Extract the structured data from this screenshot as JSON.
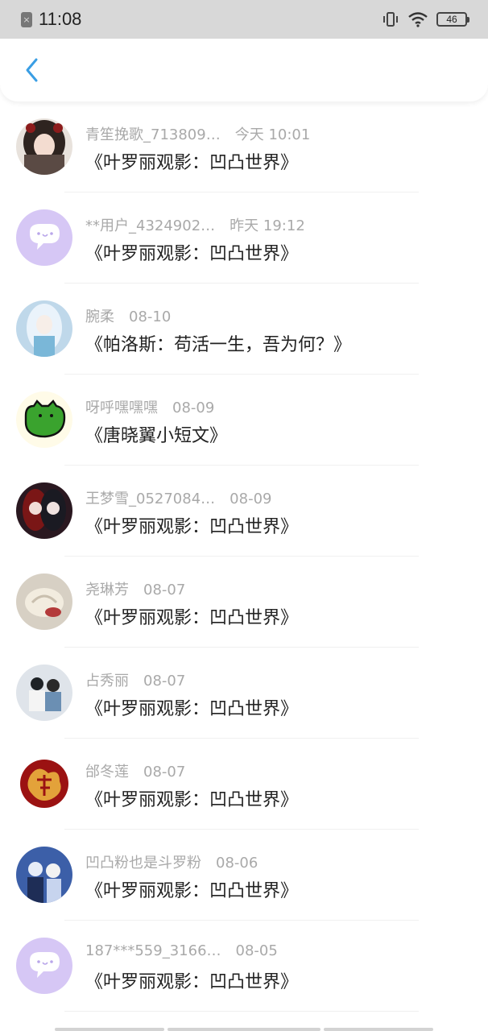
{
  "status_bar": {
    "time": "11:08",
    "battery": "46"
  },
  "nav": {
    "back_icon": "chevron-left-icon",
    "accent": "#3a9ee4"
  },
  "items": [
    {
      "name": "青笙挽歌_713809…",
      "time": "今天 10:01",
      "title": "《叶罗丽观影：凹凸世界》",
      "avatar": "anime-girl"
    },
    {
      "name": "**用户_4324902…",
      "time": "昨天 19:12",
      "title": "《叶罗丽观影：凹凸世界》",
      "avatar": "default-chat"
    },
    {
      "name": "腕柔",
      "time": "08-10",
      "title": "《帕洛斯：苟活一生，吾为何？》",
      "avatar": "blue-anime"
    },
    {
      "name": "呀呼嘿嘿嘿",
      "time": "08-09",
      "title": "《唐晓翼小短文》",
      "avatar": "green-cat"
    },
    {
      "name": "王梦雪_0527084…",
      "time": "08-09",
      "title": "《叶罗丽观影：凹凸世界》",
      "avatar": "dark-anime"
    },
    {
      "name": "尧琳芳",
      "time": "08-07",
      "title": "《叶罗丽观影：凹凸世界》",
      "avatar": "flower"
    },
    {
      "name": "占秀丽",
      "time": "08-07",
      "title": "《叶罗丽观影：凹凸世界》",
      "avatar": "couple"
    },
    {
      "name": "邰冬莲",
      "time": "08-07",
      "title": "《叶罗丽观影：凹凸世界》",
      "avatar": "fu-character"
    },
    {
      "name": "凹凸粉也是斗罗粉",
      "time": "08-06",
      "title": "《叶罗丽观影：凹凸世界》",
      "avatar": "anime-pair"
    },
    {
      "name": "187***559_3166…",
      "time": "08-05",
      "title": "《叶罗丽观影：凹凸世界》",
      "avatar": "default-chat"
    }
  ]
}
